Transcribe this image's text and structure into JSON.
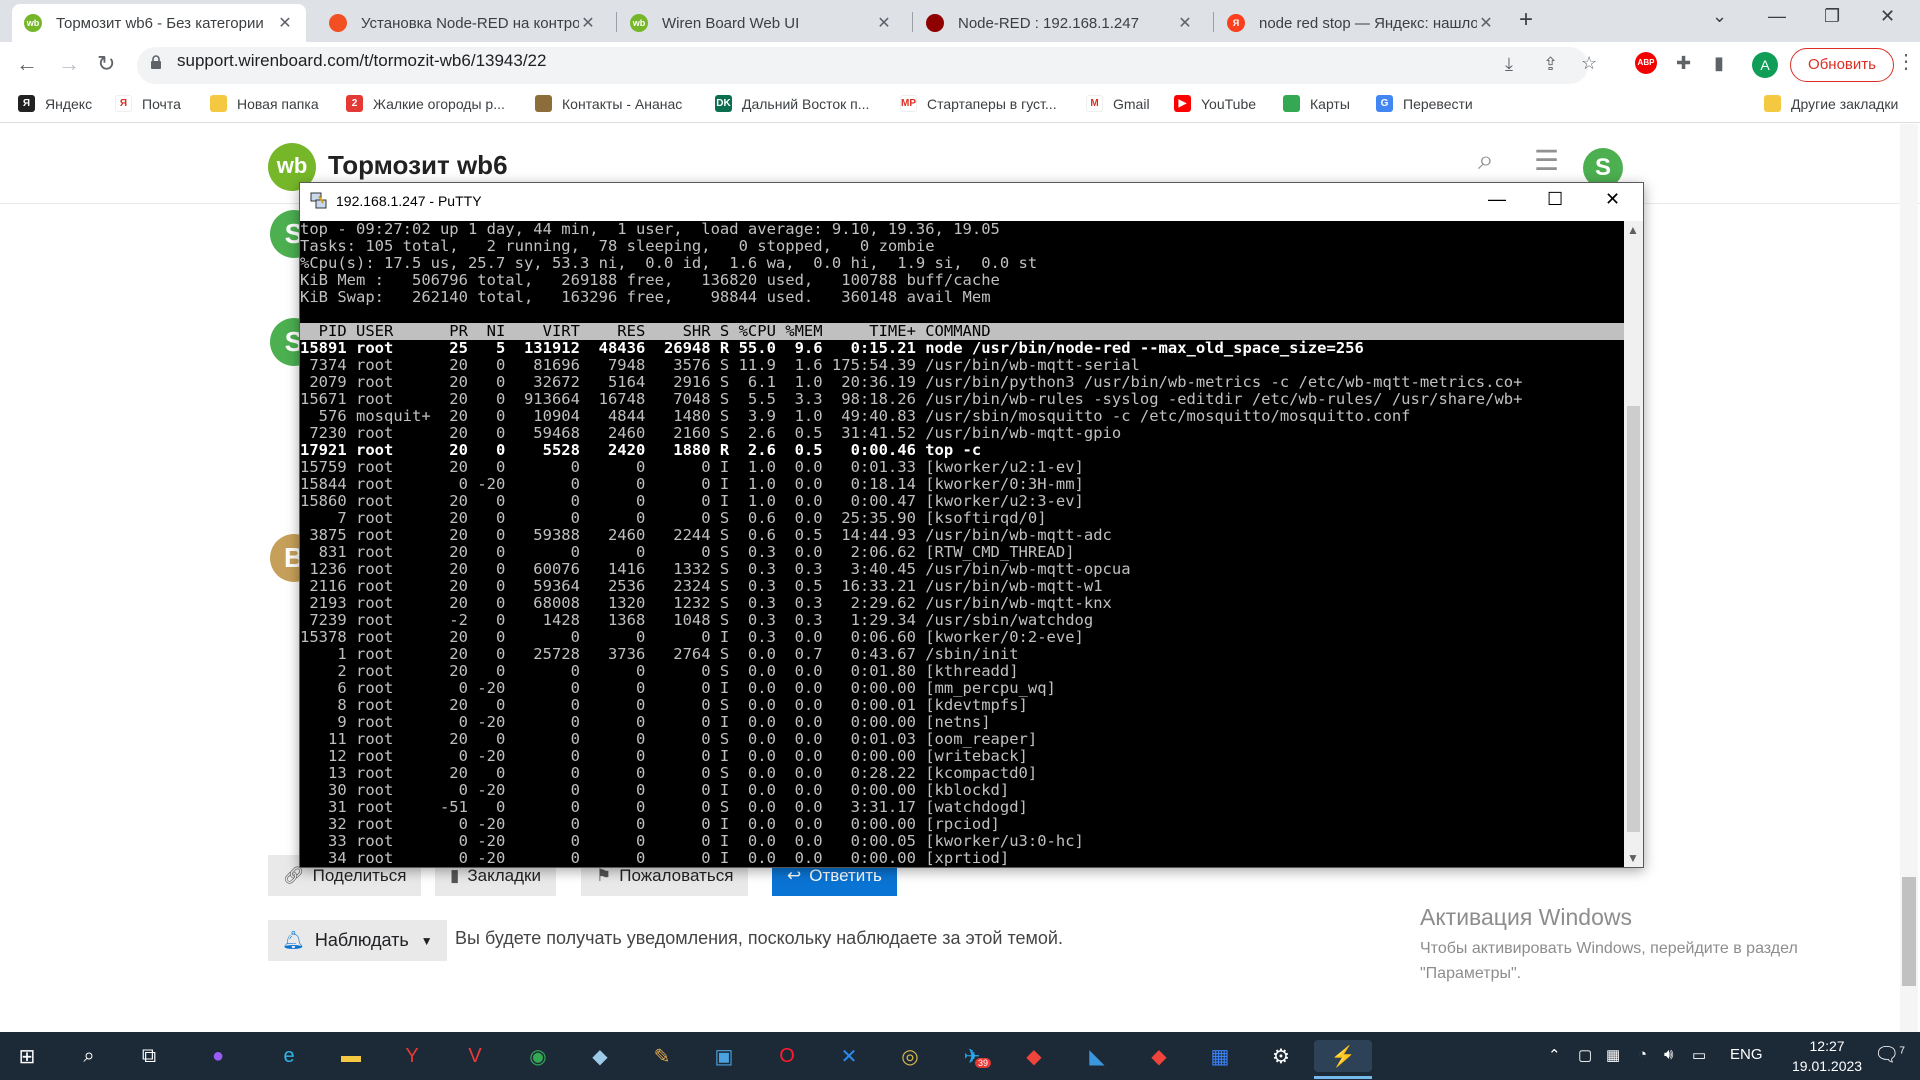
{
  "browser": {
    "tabs": [
      {
        "title": "Тормозит wb6 - Без категории",
        "active": true,
        "favicon": "wb-favicon",
        "color": "#76b72a",
        "glyph": "wb"
      },
      {
        "title": "Установка Node-RED на контро",
        "active": false,
        "favicon": "windows-favicon",
        "color": "#f25022",
        "glyph": ""
      },
      {
        "title": "Wiren Board Web UI",
        "active": false,
        "favicon": "wb-favicon",
        "color": "#76b72a",
        "glyph": "wb"
      },
      {
        "title": "Node-RED : 192.168.1.247",
        "active": false,
        "favicon": "node-red-favicon",
        "color": "#8f0000",
        "glyph": ""
      },
      {
        "title": "node red stop — Яндекс: нашло",
        "active": false,
        "favicon": "yandex-favicon",
        "color": "#fc3f1d",
        "glyph": "Я"
      }
    ],
    "url": "support.wirenboard.com/t/tormozit-wb6/13943/22",
    "update_label": "Обновить",
    "avatar_letter": "A",
    "extension_label": "ABP",
    "bookmarks": [
      {
        "label": "Яндекс",
        "icon": "yandex-icon",
        "color": "#222222",
        "glyph": "Я"
      },
      {
        "label": "Почта",
        "icon": "mail-icon",
        "color": "#ffffff",
        "glyph": "Я"
      },
      {
        "label": "Новая папка",
        "icon": "folder-icon",
        "color": "#f5c842",
        "glyph": ""
      },
      {
        "label": "Жалкие огороды р...",
        "icon": "site-icon",
        "color": "#e53935",
        "glyph": "2"
      },
      {
        "label": "Контакты - Ананас",
        "icon": "pineapple-icon",
        "color": "#8d6e3b",
        "glyph": ""
      },
      {
        "label": "Дальний Восток п...",
        "icon": "dk-icon",
        "color": "#0b6e4f",
        "glyph": "DK"
      },
      {
        "label": "Стартаперы в густ...",
        "icon": "mp-icon",
        "color": "#ffffff",
        "glyph": "MP"
      },
      {
        "label": "Gmail",
        "icon": "gmail-icon",
        "color": "#ffffff",
        "glyph": "M"
      },
      {
        "label": "YouTube",
        "icon": "youtube-icon",
        "color": "#ff0000",
        "glyph": "▶"
      },
      {
        "label": "Карты",
        "icon": "maps-icon",
        "color": "#34a853",
        "glyph": ""
      },
      {
        "label": "Перевести",
        "icon": "translate-icon",
        "color": "#4285f4",
        "glyph": "G"
      }
    ],
    "other_bookmarks": "Другие закладки"
  },
  "site": {
    "logo": "wb",
    "topic_title": "Тормозит wb6",
    "post_avatars": [
      {
        "letter": "S",
        "color": "#4caf50"
      },
      {
        "letter": "S",
        "color": "#4caf50"
      },
      {
        "letter": "B",
        "color": "#c6a05a"
      }
    ],
    "header_avatar": "S",
    "post_buttons": [
      {
        "label": "Поделиться",
        "icon": "link-icon"
      },
      {
        "label": "Закладки",
        "icon": "bookmark-icon"
      },
      {
        "label": "Пожаловаться",
        "icon": "flag-icon"
      },
      {
        "label": "Ответить",
        "icon": "reply-icon"
      }
    ],
    "watch_label": "Наблюдать",
    "watch_note": "Вы будете получать уведомления, поскольку наблюдаете за этой темой.",
    "activation_title": "Активация Windows",
    "activation_text_1": "Чтобы активировать Windows, перейдите в раздел",
    "activation_text_2": "\"Параметры\"."
  },
  "putty": {
    "title": "192.168.1.247 - PuTTY",
    "summary": [
      "top - 09:27:02 up 1 day, 44 min,  1 user,  load average: 9.10, 19.36, 19.05",
      "Tasks: 105 total,   2 running,  78 sleeping,   0 stopped,   0 zombie",
      "%Cpu(s): 17.5 us, 25.7 sy, 53.3 ni,  0.0 id,  1.6 wa,  0.0 hi,  1.9 si,  0.0 st",
      "KiB Mem :   506796 total,   269188 free,   136820 used,   100788 buff/cache",
      "KiB Swap:   262140 total,   163296 free,    98844 used.   360148 avail Mem",
      ""
    ],
    "columns": [
      "PID",
      "USER",
      "PR",
      "NI",
      "VIRT",
      "RES",
      "SHR",
      "S",
      "%CPU",
      "%MEM",
      "TIME+",
      "COMMAND"
    ],
    "processes": [
      {
        "pid": "15891",
        "user": "root",
        "pr": "25",
        "ni": "5",
        "virt": "131912",
        "res": "48436",
        "shr": "26948",
        "s": "R",
        "cpu": "55.0",
        "mem": "9.6",
        "time": "0:15.21",
        "cmd": "node /usr/bin/node-red --max_old_space_size=256",
        "hl": true
      },
      {
        "pid": "7374",
        "user": "root",
        "pr": "20",
        "ni": "0",
        "virt": "81696",
        "res": "7948",
        "shr": "3576",
        "s": "S",
        "cpu": "11.9",
        "mem": "1.6",
        "time": "175:54.39",
        "cmd": "/usr/bin/wb-mqtt-serial",
        "hl": false
      },
      {
        "pid": "2079",
        "user": "root",
        "pr": "20",
        "ni": "0",
        "virt": "32672",
        "res": "5164",
        "shr": "2916",
        "s": "S",
        "cpu": "6.1",
        "mem": "1.0",
        "time": "20:36.19",
        "cmd": "/usr/bin/python3 /usr/bin/wb-metrics -c /etc/wb-mqtt-metrics.co+",
        "hl": false
      },
      {
        "pid": "15671",
        "user": "root",
        "pr": "20",
        "ni": "0",
        "virt": "913664",
        "res": "16748",
        "shr": "7048",
        "s": "S",
        "cpu": "5.5",
        "mem": "3.3",
        "time": "98:18.26",
        "cmd": "/usr/bin/wb-rules -syslog -editdir /etc/wb-rules/ /usr/share/wb+",
        "hl": false
      },
      {
        "pid": "576",
        "user": "mosquit+",
        "pr": "20",
        "ni": "0",
        "virt": "10904",
        "res": "4844",
        "shr": "1480",
        "s": "S",
        "cpu": "3.9",
        "mem": "1.0",
        "time": "49:40.83",
        "cmd": "/usr/sbin/mosquitto -c /etc/mosquitto/mosquitto.conf",
        "hl": false
      },
      {
        "pid": "7230",
        "user": "root",
        "pr": "20",
        "ni": "0",
        "virt": "59468",
        "res": "2460",
        "shr": "2160",
        "s": "S",
        "cpu": "2.6",
        "mem": "0.5",
        "time": "31:41.52",
        "cmd": "/usr/bin/wb-mqtt-gpio",
        "hl": false
      },
      {
        "pid": "17921",
        "user": "root",
        "pr": "20",
        "ni": "0",
        "virt": "5528",
        "res": "2420",
        "shr": "1880",
        "s": "R",
        "cpu": "2.6",
        "mem": "0.5",
        "time": "0:00.46",
        "cmd": "top -c",
        "hl": true
      },
      {
        "pid": "15759",
        "user": "root",
        "pr": "20",
        "ni": "0",
        "virt": "0",
        "res": "0",
        "shr": "0",
        "s": "I",
        "cpu": "1.0",
        "mem": "0.0",
        "time": "0:01.33",
        "cmd": "[kworker/u2:1-ev]",
        "hl": false
      },
      {
        "pid": "15844",
        "user": "root",
        "pr": "0",
        "ni": "-20",
        "virt": "0",
        "res": "0",
        "shr": "0",
        "s": "I",
        "cpu": "1.0",
        "mem": "0.0",
        "time": "0:18.14",
        "cmd": "[kworker/0:3H-mm]",
        "hl": false
      },
      {
        "pid": "15860",
        "user": "root",
        "pr": "20",
        "ni": "0",
        "virt": "0",
        "res": "0",
        "shr": "0",
        "s": "I",
        "cpu": "1.0",
        "mem": "0.0",
        "time": "0:00.47",
        "cmd": "[kworker/u2:3-ev]",
        "hl": false
      },
      {
        "pid": "7",
        "user": "root",
        "pr": "20",
        "ni": "0",
        "virt": "0",
        "res": "0",
        "shr": "0",
        "s": "S",
        "cpu": "0.6",
        "mem": "0.0",
        "time": "25:35.90",
        "cmd": "[ksoftirqd/0]",
        "hl": false
      },
      {
        "pid": "3875",
        "user": "root",
        "pr": "20",
        "ni": "0",
        "virt": "59388",
        "res": "2460",
        "shr": "2244",
        "s": "S",
        "cpu": "0.6",
        "mem": "0.5",
        "time": "14:44.93",
        "cmd": "/usr/bin/wb-mqtt-adc",
        "hl": false
      },
      {
        "pid": "831",
        "user": "root",
        "pr": "20",
        "ni": "0",
        "virt": "0",
        "res": "0",
        "shr": "0",
        "s": "S",
        "cpu": "0.3",
        "mem": "0.0",
        "time": "2:06.62",
        "cmd": "[RTW_CMD_THREAD]",
        "hl": false
      },
      {
        "pid": "1236",
        "user": "root",
        "pr": "20",
        "ni": "0",
        "virt": "60076",
        "res": "1416",
        "shr": "1332",
        "s": "S",
        "cpu": "0.3",
        "mem": "0.3",
        "time": "3:40.45",
        "cmd": "/usr/bin/wb-mqtt-opcua",
        "hl": false
      },
      {
        "pid": "2116",
        "user": "root",
        "pr": "20",
        "ni": "0",
        "virt": "59364",
        "res": "2536",
        "shr": "2324",
        "s": "S",
        "cpu": "0.3",
        "mem": "0.5",
        "time": "16:33.21",
        "cmd": "/usr/bin/wb-mqtt-w1",
        "hl": false
      },
      {
        "pid": "2193",
        "user": "root",
        "pr": "20",
        "ni": "0",
        "virt": "68008",
        "res": "1320",
        "shr": "1232",
        "s": "S",
        "cpu": "0.3",
        "mem": "0.3",
        "time": "2:29.62",
        "cmd": "/usr/bin/wb-mqtt-knx",
        "hl": false
      },
      {
        "pid": "7239",
        "user": "root",
        "pr": "-2",
        "ni": "0",
        "virt": "1428",
        "res": "1368",
        "shr": "1048",
        "s": "S",
        "cpu": "0.3",
        "mem": "0.3",
        "time": "1:29.34",
        "cmd": "/usr/sbin/watchdog",
        "hl": false
      },
      {
        "pid": "15378",
        "user": "root",
        "pr": "20",
        "ni": "0",
        "virt": "0",
        "res": "0",
        "shr": "0",
        "s": "I",
        "cpu": "0.3",
        "mem": "0.0",
        "time": "0:06.60",
        "cmd": "[kworker/0:2-eve]",
        "hl": false
      },
      {
        "pid": "1",
        "user": "root",
        "pr": "20",
        "ni": "0",
        "virt": "25728",
        "res": "3736",
        "shr": "2764",
        "s": "S",
        "cpu": "0.0",
        "mem": "0.7",
        "time": "0:43.67",
        "cmd": "/sbin/init",
        "hl": false
      },
      {
        "pid": "2",
        "user": "root",
        "pr": "20",
        "ni": "0",
        "virt": "0",
        "res": "0",
        "shr": "0",
        "s": "S",
        "cpu": "0.0",
        "mem": "0.0",
        "time": "0:01.80",
        "cmd": "[kthreadd]",
        "hl": false
      },
      {
        "pid": "6",
        "user": "root",
        "pr": "0",
        "ni": "-20",
        "virt": "0",
        "res": "0",
        "shr": "0",
        "s": "I",
        "cpu": "0.0",
        "mem": "0.0",
        "time": "0:00.00",
        "cmd": "[mm_percpu_wq]",
        "hl": false
      },
      {
        "pid": "8",
        "user": "root",
        "pr": "20",
        "ni": "0",
        "virt": "0",
        "res": "0",
        "shr": "0",
        "s": "S",
        "cpu": "0.0",
        "mem": "0.0",
        "time": "0:00.01",
        "cmd": "[kdevtmpfs]",
        "hl": false
      },
      {
        "pid": "9",
        "user": "root",
        "pr": "0",
        "ni": "-20",
        "virt": "0",
        "res": "0",
        "shr": "0",
        "s": "I",
        "cpu": "0.0",
        "mem": "0.0",
        "time": "0:00.00",
        "cmd": "[netns]",
        "hl": false
      },
      {
        "pid": "11",
        "user": "root",
        "pr": "20",
        "ni": "0",
        "virt": "0",
        "res": "0",
        "shr": "0",
        "s": "S",
        "cpu": "0.0",
        "mem": "0.0",
        "time": "0:01.03",
        "cmd": "[oom_reaper]",
        "hl": false
      },
      {
        "pid": "12",
        "user": "root",
        "pr": "0",
        "ni": "-20",
        "virt": "0",
        "res": "0",
        "shr": "0",
        "s": "I",
        "cpu": "0.0",
        "mem": "0.0",
        "time": "0:00.00",
        "cmd": "[writeback]",
        "hl": false
      },
      {
        "pid": "13",
        "user": "root",
        "pr": "20",
        "ni": "0",
        "virt": "0",
        "res": "0",
        "shr": "0",
        "s": "S",
        "cpu": "0.0",
        "mem": "0.0",
        "time": "0:28.22",
        "cmd": "[kcompactd0]",
        "hl": false
      },
      {
        "pid": "30",
        "user": "root",
        "pr": "0",
        "ni": "-20",
        "virt": "0",
        "res": "0",
        "shr": "0",
        "s": "I",
        "cpu": "0.0",
        "mem": "0.0",
        "time": "0:00.00",
        "cmd": "[kblockd]",
        "hl": false
      },
      {
        "pid": "31",
        "user": "root",
        "pr": "-51",
        "ni": "0",
        "virt": "0",
        "res": "0",
        "shr": "0",
        "s": "S",
        "cpu": "0.0",
        "mem": "0.0",
        "time": "3:31.17",
        "cmd": "[watchdogd]",
        "hl": false
      },
      {
        "pid": "32",
        "user": "root",
        "pr": "0",
        "ni": "-20",
        "virt": "0",
        "res": "0",
        "shr": "0",
        "s": "I",
        "cpu": "0.0",
        "mem": "0.0",
        "time": "0:00.00",
        "cmd": "[rpciod]",
        "hl": false
      },
      {
        "pid": "33",
        "user": "root",
        "pr": "0",
        "ni": "-20",
        "virt": "0",
        "res": "0",
        "shr": "0",
        "s": "I",
        "cpu": "0.0",
        "mem": "0.0",
        "time": "0:00.05",
        "cmd": "[kworker/u3:0-hc]",
        "hl": false
      },
      {
        "pid": "34",
        "user": "root",
        "pr": "0",
        "ni": "-20",
        "virt": "0",
        "res": "0",
        "shr": "0",
        "s": "I",
        "cpu": "0.0",
        "mem": "0.0",
        "time": "0:00.00",
        "cmd": "[xprtiod]",
        "hl": false
      }
    ]
  },
  "taskbar": {
    "apps": [
      {
        "name": "start-icon",
        "glyph": "⊞",
        "color": "#ffffff"
      },
      {
        "name": "search-icon",
        "glyph": "⌕",
        "color": "#ffffff"
      },
      {
        "name": "task-view-icon",
        "glyph": "⧉",
        "color": "#ffffff"
      },
      {
        "name": "alice-icon",
        "glyph": "●",
        "color": "#9b5cf6"
      },
      {
        "name": "edge-icon",
        "glyph": "e",
        "color": "#2fb5e8"
      },
      {
        "name": "explorer-icon",
        "glyph": "▬",
        "color": "#f5c842"
      },
      {
        "name": "yandex-browser-icon",
        "glyph": "Y",
        "color": "#e53935"
      },
      {
        "name": "vivaldi-icon",
        "glyph": "V",
        "color": "#ef3939"
      },
      {
        "name": "chrome-icon",
        "glyph": "◉",
        "color": "#34a853"
      },
      {
        "name": "app-icon",
        "glyph": "◆",
        "color": "#9ec9e8"
      },
      {
        "name": "paint-icon",
        "glyph": "✎",
        "color": "#e0a44b"
      },
      {
        "name": "remote-desktop-icon",
        "glyph": "▣",
        "color": "#4aa3df"
      },
      {
        "name": "opera-icon",
        "glyph": "O",
        "color": "#ff1b2d"
      },
      {
        "name": "tools-icon",
        "glyph": "✕",
        "color": "#2d8cf0"
      },
      {
        "name": "eye-icon",
        "glyph": "◎",
        "color": "#d8b84a"
      },
      {
        "name": "telegram-icon",
        "glyph": "✈",
        "color": "#29a9eb",
        "badge": "39"
      },
      {
        "name": "anydesk-icon",
        "glyph": "◆",
        "color": "#ef443b"
      },
      {
        "name": "vscode-icon",
        "glyph": "◣",
        "color": "#3a96dd"
      },
      {
        "name": "anydesk-icon-2",
        "glyph": "◆",
        "color": "#ef443b"
      },
      {
        "name": "grid-app-icon",
        "glyph": "▦",
        "color": "#3b82f6"
      },
      {
        "name": "settings-icon",
        "glyph": "⚙",
        "color": "#ffffff"
      },
      {
        "name": "putty-icon",
        "glyph": "⚡",
        "color": "#f5c842"
      }
    ],
    "lang": "ENG",
    "time": "12:27",
    "date": "19.01.2023",
    "notification_count": "7"
  }
}
